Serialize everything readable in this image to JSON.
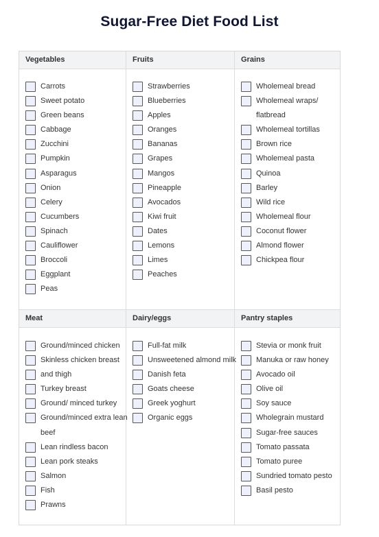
{
  "title": "Sugar-Free Diet Food List",
  "sections_top": [
    {
      "heading": "Vegetables",
      "items": [
        "Carrots",
        "Sweet potato",
        "Green beans",
        "Cabbage",
        "Zucchini",
        "Pumpkin",
        "Asparagus",
        "Onion",
        "Celery",
        "Cucumbers",
        "Spinach",
        "Cauliflower",
        "Broccoli",
        "Eggplant",
        "Peas"
      ]
    },
    {
      "heading": "Fruits",
      "items": [
        "Strawberries",
        "Blueberries",
        "Apples",
        "Oranges",
        "Bananas",
        "Grapes",
        "Mangos",
        "Pineapple",
        "Avocados",
        "Kiwi fruit",
        "Dates",
        "Lemons",
        "Limes",
        "Peaches"
      ]
    },
    {
      "heading": "Grains",
      "items": [
        "Wholemeal bread",
        "Wholemeal wraps/",
        "flatbread",
        "Wholemeal tortillas",
        "Brown rice",
        "Wholemeal pasta",
        "Quinoa",
        "Barley",
        "Wild rice",
        "Wholemeal flour",
        "Coconut flower",
        "Almond flower",
        "Chickpea flour"
      ]
    }
  ],
  "sections_bottom": [
    {
      "heading": "Meat",
      "items": [
        "Ground/minced chicken",
        "Skinless chicken breast",
        "and thigh",
        "Turkey breast",
        "Ground/ minced turkey",
        "Ground/minced extra lean",
        "beef",
        "Lean rindless bacon",
        "Lean pork steaks",
        "Salmon",
        "Fish",
        "Prawns"
      ]
    },
    {
      "heading": "Dairy/eggs",
      "items": [
        "Full-fat milk",
        "Unsweetened almond milk",
        "Danish feta",
        "Goats cheese",
        "Greek yoghurt",
        "Organic eggs"
      ]
    },
    {
      "heading": "Pantry staples",
      "items": [
        "Stevia or monk fruit",
        "Manuka or raw honey",
        "Avocado oil",
        "Olive oil",
        "Soy sauce",
        "Wholegrain mustard",
        "Sugar-free sauces",
        "Tomato passata",
        "Tomato puree",
        "Sundried tomato pesto",
        "Basil pesto"
      ]
    }
  ],
  "continuation_lines": {
    "sections_top.2": [
      2
    ],
    "sections_bottom.0": [
      6
    ]
  },
  "colors": {
    "title": "#0f1638",
    "header_bg": "#f2f3f4",
    "checkbox_fill": "#eef0fc",
    "border": "#dcdcdc"
  }
}
